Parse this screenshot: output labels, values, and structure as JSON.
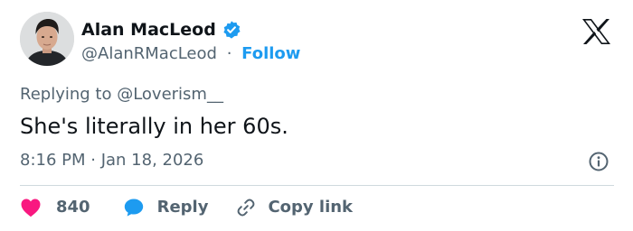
{
  "author": {
    "display_name": "Alan MacLeod",
    "handle": "@AlanRMacLeod",
    "separator": "·",
    "follow_label": "Follow",
    "verified": true
  },
  "tweet": {
    "replying_to": "Replying to @Loverism__",
    "text": "She's literally in her 60s.",
    "timestamp": "8:16 PM · Jan 18, 2026"
  },
  "actions": {
    "like_count": "840",
    "reply_label": "Reply",
    "copy_link_label": "Copy link"
  },
  "icons": {
    "logo": "x-logo-icon",
    "verified": "verified-badge-icon",
    "info": "info-icon",
    "like": "heart-icon",
    "reply": "speech-bubble-icon",
    "copy": "link-icon"
  },
  "colors": {
    "text_primary": "#0f1419",
    "text_secondary": "#536471",
    "accent_blue": "#1d9bf0",
    "like_pink": "#f91880",
    "divider": "#cfd9de"
  }
}
